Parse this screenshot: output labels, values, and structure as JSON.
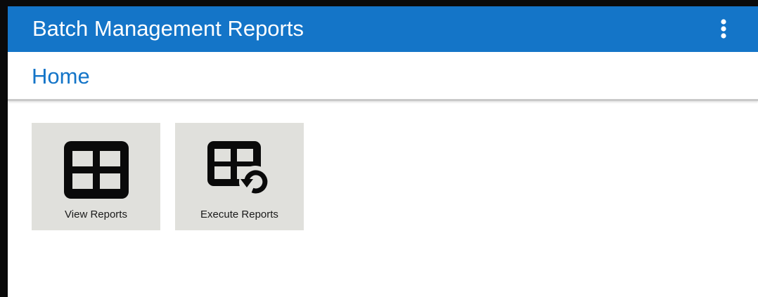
{
  "app": {
    "title": "Batch Management Reports",
    "menu_icon": "more-vertical-icon"
  },
  "page": {
    "title": "Home"
  },
  "tiles": [
    {
      "label": "View Reports",
      "icon": "table-grid-icon"
    },
    {
      "label": "Execute Reports",
      "icon": "table-refresh-icon"
    }
  ],
  "colors": {
    "brand": "#1475c8",
    "tile_background": "#e0e0dc",
    "icon": "#0a0a0a"
  }
}
